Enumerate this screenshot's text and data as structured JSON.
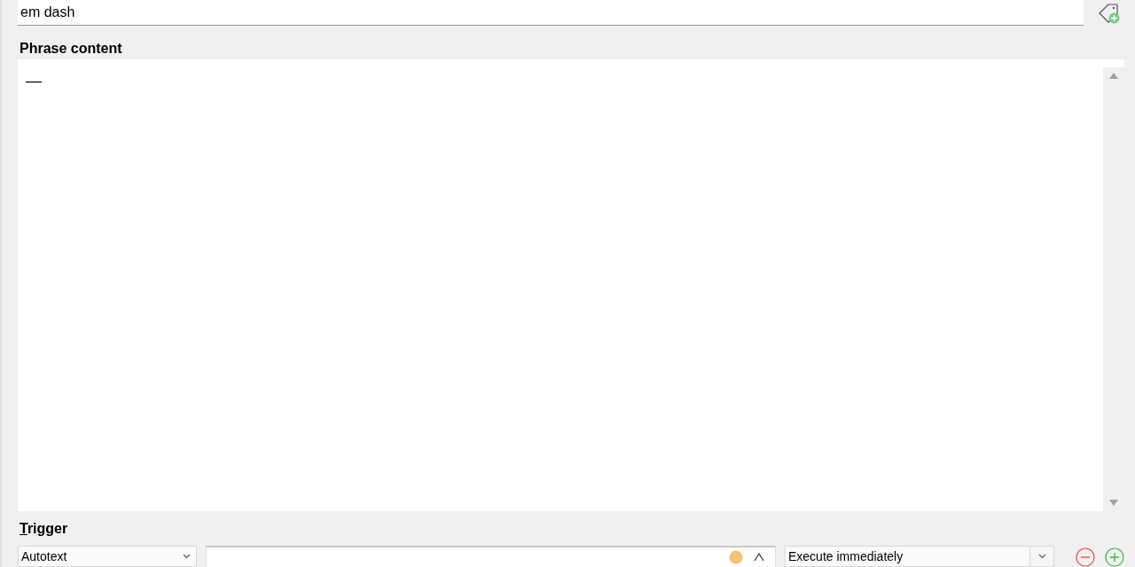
{
  "name_field": {
    "value": "em dash"
  },
  "phrase_content": {
    "label": "Phrase content",
    "value": "—"
  },
  "trigger": {
    "label": "Trigger",
    "type_dropdown": {
      "value": "Autotext"
    },
    "execution_dropdown": {
      "value": "Execute immediately"
    }
  }
}
